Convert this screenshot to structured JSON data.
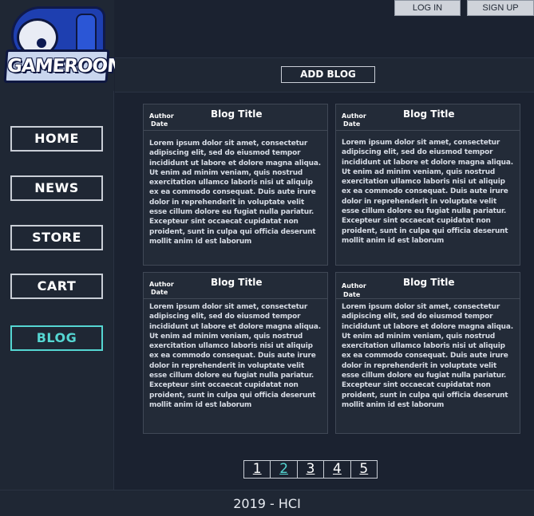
{
  "logo": {
    "text": "GAMEROOM"
  },
  "header": {
    "login": "LOG IN",
    "signup": "SIGN UP"
  },
  "nav": {
    "items": [
      {
        "label": "HOME"
      },
      {
        "label": "NEWS"
      },
      {
        "label": "STORE"
      },
      {
        "label": "CART"
      },
      {
        "label": "BLOG",
        "active": true
      }
    ]
  },
  "add_blog": "ADD BLOG",
  "cards": [
    {
      "author": "Author",
      "date": "Date",
      "title": "Blog Title",
      "body": "Lorem ipsum dolor sit amet, consectetur adipiscing elit, sed do eiusmod tempor incididunt ut labore et dolore magna aliqua. Ut enim ad minim veniam, quis nostrud exercitation ullamco laboris nisi ut aliquip ex ea commodo consequat. Duis aute irure dolor in reprehenderit in voluptate velit esse cillum dolore eu fugiat nulla pariatur. Excepteur sint occaecat cupidatat non proident, sunt in culpa qui officia deserunt mollit anim id est laborum"
    },
    {
      "author": "Author",
      "date": "Date",
      "title": "Blog Title",
      "body": "Lorem ipsum dolor sit amet, consectetur adipiscing elit, sed do eiusmod tempor incididunt ut labore et dolore magna aliqua. Ut enim ad minim veniam, quis nostrud exercitation ullamco laboris nisi ut aliquip ex ea commodo consequat. Duis aute irure dolor in reprehenderit in voluptate velit esse cillum dolore eu fugiat nulla pariatur. Excepteur sint occaecat cupidatat non proident, sunt in culpa qui officia deserunt mollit anim id est laborum"
    },
    {
      "author": "Author",
      "date": "Date",
      "title": "Blog Title",
      "body": "Lorem ipsum dolor sit amet, consectetur adipiscing elit, sed do eiusmod tempor incididunt ut labore et dolore magna aliqua. Ut enim ad minim veniam, quis nostrud exercitation ullamco laboris nisi ut aliquip ex ea commodo consequat. Duis aute irure dolor in reprehenderit in voluptate velit esse cillum dolore eu fugiat nulla pariatur. Excepteur sint occaecat cupidatat non proident, sunt in culpa qui officia deserunt mollit anim id est laborum"
    },
    {
      "author": "Author",
      "date": "Date",
      "title": "Blog Title",
      "body": "Lorem ipsum dolor sit amet, consectetur adipiscing elit, sed do eiusmod tempor incididunt ut labore et dolore magna aliqua. Ut enim ad minim veniam, quis nostrud exercitation ullamco laboris nisi ut aliquip ex ea commodo consequat. Duis aute irure dolor in reprehenderit in voluptate velit esse cillum dolore eu fugiat nulla pariatur. Excepteur sint occaecat cupidatat non proident, sunt in culpa qui officia deserunt mollit anim id est laborum"
    }
  ],
  "pagination": {
    "pages": [
      "1",
      "2",
      "3",
      "4",
      "5"
    ],
    "current": "2"
  },
  "footer": {
    "text": "2019 - HCI"
  },
  "colors": {
    "accent": "#55d6d2",
    "background": "#1b2230",
    "panel": "#1f2734",
    "logo_blue": "#1e3fb0"
  }
}
